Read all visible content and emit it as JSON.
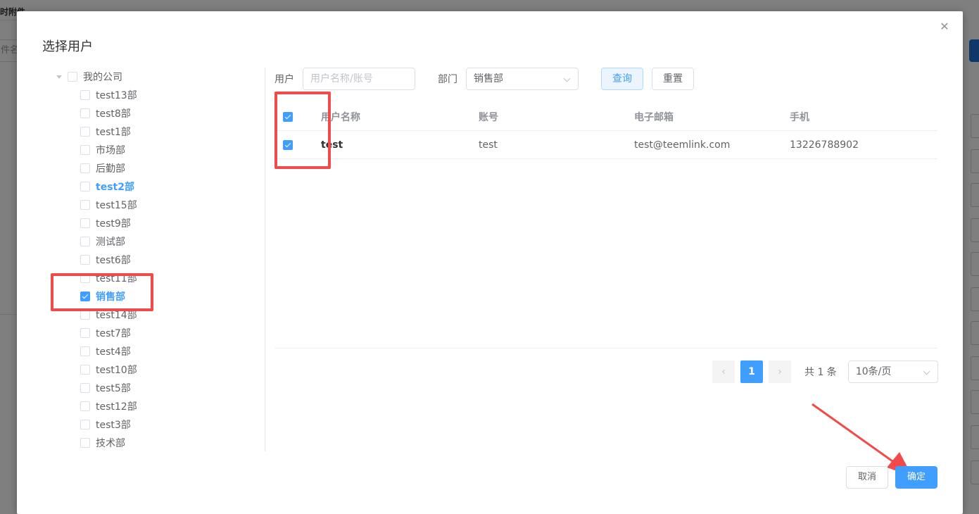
{
  "background": {
    "top_text": "时附件",
    "input_text": "件名"
  },
  "dialog": {
    "title": "选择用户",
    "close_icon": "close-icon"
  },
  "tree": {
    "root_label": "我的公司",
    "items": [
      {
        "label": "test13部",
        "state": "unchecked"
      },
      {
        "label": "test8部",
        "state": "unchecked"
      },
      {
        "label": "test1部",
        "state": "unchecked"
      },
      {
        "label": "市场部",
        "state": "unchecked"
      },
      {
        "label": "后勤部",
        "state": "unchecked"
      },
      {
        "label": "test2部",
        "state": "current"
      },
      {
        "label": "test15部",
        "state": "unchecked"
      },
      {
        "label": "test9部",
        "state": "unchecked"
      },
      {
        "label": "测试部",
        "state": "unchecked"
      },
      {
        "label": "test6部",
        "state": "unchecked"
      },
      {
        "label": "test11部",
        "state": "unchecked"
      },
      {
        "label": "销售部",
        "state": "checked"
      },
      {
        "label": "test14部",
        "state": "unchecked"
      },
      {
        "label": "test7部",
        "state": "unchecked"
      },
      {
        "label": "test4部",
        "state": "unchecked"
      },
      {
        "label": "test10部",
        "state": "unchecked"
      },
      {
        "label": "test5部",
        "state": "unchecked"
      },
      {
        "label": "test12部",
        "state": "unchecked"
      },
      {
        "label": "test3部",
        "state": "unchecked"
      },
      {
        "label": "技术部",
        "state": "unchecked"
      }
    ]
  },
  "search": {
    "user_label": "用户",
    "user_placeholder": "用户名称/账号",
    "dept_label": "部门",
    "dept_value": "销售部",
    "query_button": "查询",
    "reset_button": "重置"
  },
  "table": {
    "columns": [
      "用户名称",
      "账号",
      "电子邮箱",
      "手机"
    ],
    "header_checked": true,
    "rows": [
      {
        "checked": true,
        "name": "test",
        "account": "test",
        "email": "test@teemlink.com",
        "phone": "13226788902"
      }
    ]
  },
  "pagination": {
    "prev_icon": "‹",
    "next_icon": "›",
    "current_page": "1",
    "total_text": "共 1 条",
    "page_size": "10条/页"
  },
  "footer": {
    "cancel_button": "取消",
    "confirm_button": "确定"
  },
  "colors": {
    "primary": "#409eff",
    "annotation_red": "#f04a4a"
  }
}
